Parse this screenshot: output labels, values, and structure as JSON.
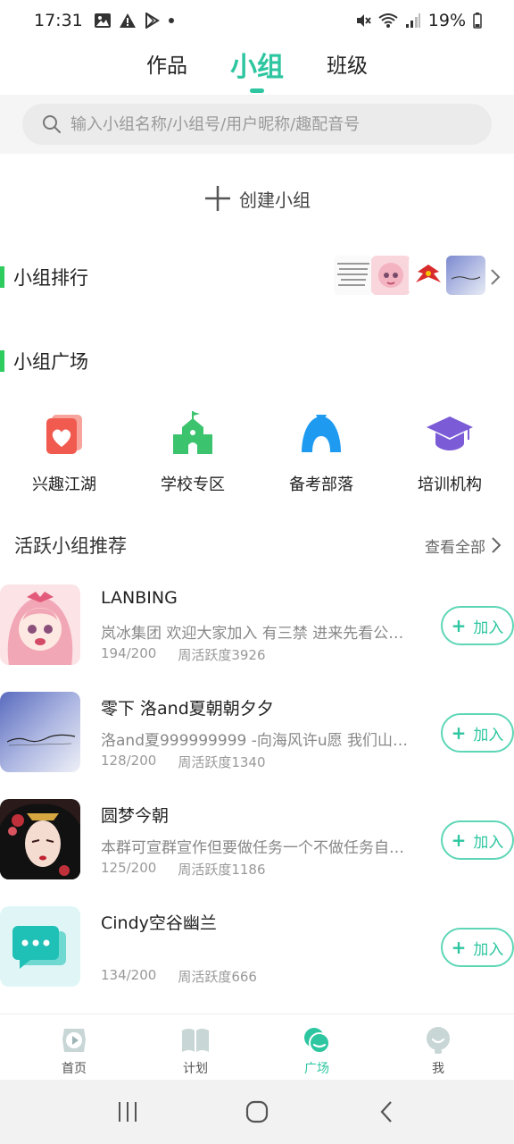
{
  "status_bar": {
    "time": "17:31",
    "battery": "19%"
  },
  "top_tabs": [
    {
      "label": "作品",
      "active": false
    },
    {
      "label": "小组",
      "active": true
    },
    {
      "label": "班级",
      "active": false
    }
  ],
  "search": {
    "placeholder": "输入小组名称/小组号/用户昵称/趣配音号"
  },
  "create_group": {
    "label": "创建小组"
  },
  "sections": {
    "ranking": "小组排行",
    "plaza": "小组广场"
  },
  "plaza_items": [
    {
      "label": "兴趣江湖",
      "icon": "heart-card-icon",
      "color": "#f05a4f"
    },
    {
      "label": "学校专区",
      "icon": "school-building-icon",
      "color": "#3cc36e"
    },
    {
      "label": "备考部落",
      "icon": "tent-icon",
      "color": "#1e9bf0"
    },
    {
      "label": "培训机构",
      "icon": "graduation-cap-icon",
      "color": "#7b5cd6"
    }
  ],
  "active_groups": {
    "title": "活跃小组推荐",
    "view_all": "查看全部",
    "join_label": "加入",
    "items": [
      {
        "name": "LANBING",
        "desc": "岚冰集团 欢迎大家加入 有三禁 进来先看公告…",
        "members": "194/200",
        "activity": "周活跃度3926"
      },
      {
        "name": "零下 洛and夏朝朝夕夕",
        "desc": "洛and夏999999999 -向海风许u愿 我们山海…",
        "members": "128/200",
        "activity": "周活跃度1340"
      },
      {
        "name": "圆梦今朝",
        "desc": "本群可宣群宣作但要做任务一个不做任务自己…",
        "members": "125/200",
        "activity": "周活跃度1186"
      },
      {
        "name": "Cindy空谷幽兰",
        "desc": "",
        "members": "134/200",
        "activity": "周活跃度666"
      }
    ]
  },
  "bottom_nav": [
    {
      "label": "首页",
      "icon": "play-icon",
      "active": false
    },
    {
      "label": "计划",
      "icon": "book-icon",
      "active": false
    },
    {
      "label": "广场",
      "icon": "chat-bubble-icon",
      "active": true
    },
    {
      "label": "我",
      "icon": "profile-icon",
      "active": false
    }
  ],
  "colors": {
    "accent": "#2dc6a0",
    "section_bar": "#2ecb5f"
  }
}
